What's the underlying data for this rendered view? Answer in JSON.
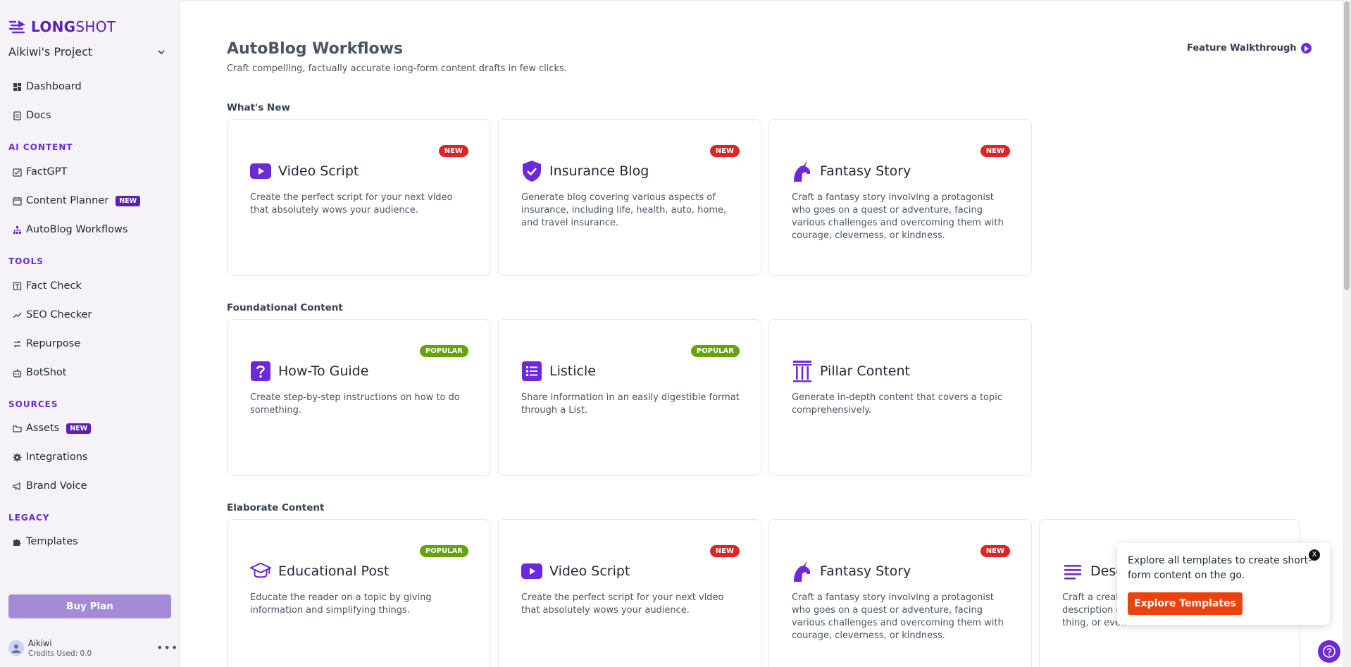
{
  "brand": {
    "bold": "LONG",
    "light": "SHOT"
  },
  "project": {
    "name": "Aikiwi's Project"
  },
  "sidebar": {
    "top": [
      {
        "label": "Dashboard"
      },
      {
        "label": "Docs"
      }
    ],
    "sections": [
      {
        "label": "AI CONTENT"
      },
      {
        "label": "TOOLS"
      },
      {
        "label": "SOURCES"
      },
      {
        "label": "LEGACY"
      }
    ],
    "items": [
      {
        "label": "FactGPT"
      },
      {
        "label": "Content Planner",
        "badge": "NEW"
      },
      {
        "label": "AutoBlog Workflows"
      },
      {
        "label": "Fact Check"
      },
      {
        "label": "SEO Checker"
      },
      {
        "label": "Repurpose"
      },
      {
        "label": "BotShot"
      },
      {
        "label": "Assets",
        "badge": "NEW"
      },
      {
        "label": "Integrations"
      },
      {
        "label": "Brand Voice"
      },
      {
        "label": "Templates"
      }
    ],
    "buy_label": "Buy Plan",
    "user": {
      "name": "Aikiwi",
      "credits": "Credits Used: 0.0"
    }
  },
  "header": {
    "title": "AutoBlog Workflows",
    "subtitle": "Craft compelling, factually accurate long-form content drafts in few clicks.",
    "walkthrough": "Feature Walkthrough"
  },
  "sections": [
    {
      "title": "What's New"
    },
    {
      "title": "Foundational Content"
    },
    {
      "title": "Elaborate Content"
    }
  ],
  "cards": [
    {
      "title": "Video Script",
      "tag": "NEW",
      "desc": "Create the perfect script for your next video that absolutely wows your audience.",
      "icon": "youtube-icon"
    },
    {
      "title": "Insurance Blog",
      "tag": "NEW",
      "desc": "Generate blog covering various aspects of insurance, including life, health, auto, home, and travel insurance.",
      "icon": "shield-check-icon"
    },
    {
      "title": "Fantasy Story",
      "tag": "NEW",
      "desc": "Craft a fantasy story involving a protagonist who goes on a quest or adventure, facing various challenges and overcoming them with courage, cleverness, or kindness.",
      "icon": "unicorn-icon"
    },
    {
      "title": "How-To Guide",
      "tag": "POPULAR",
      "desc": "Create step-by-step instructions on how to do something.",
      "icon": "question-icon"
    },
    {
      "title": "Listicle",
      "tag": "POPULAR",
      "desc": "Share information in an easily digestible format through a List.",
      "icon": "list-icon"
    },
    {
      "title": "Pillar Content",
      "tag": "",
      "desc": "Generate in-depth content that covers a topic comprehensively.",
      "icon": "pillar-icon"
    },
    {
      "title": "Educational Post",
      "tag": "POPULAR",
      "desc": "Educate the reader on a topic by giving information and simplifying things.",
      "icon": "graduation-cap-icon"
    },
    {
      "title": "Video Script",
      "tag": "NEW",
      "desc": "Create the perfect script for your next video that absolutely wows your audience.",
      "icon": "youtube-icon"
    },
    {
      "title": "Fantasy Story",
      "tag": "NEW",
      "desc": "Craft a fantasy story involving a protagonist who goes on a quest or adventure, facing various challenges and overcoming them with courage, cleverness, or kindness.",
      "icon": "unicorn-icon"
    },
    {
      "title": "Desc",
      "tag": "",
      "desc": "Craft a creat description c thing, or even",
      "icon": "text-lines-icon"
    }
  ],
  "popup": {
    "text": "Explore all templates to create short-form content on the go.",
    "button": "Explore Templates",
    "close": "X"
  },
  "colors": {
    "accent": "#6d28d9",
    "new_badge": "#dc2626",
    "popular_badge": "#65a30d",
    "cta": "#e8440f"
  }
}
